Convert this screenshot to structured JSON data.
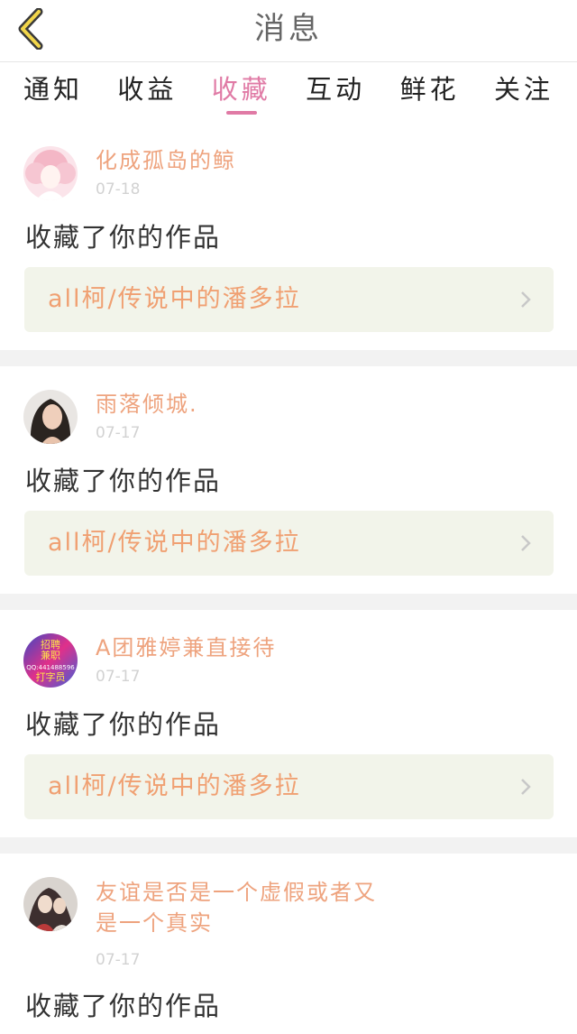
{
  "header": {
    "title": "消息"
  },
  "tabs": [
    {
      "label": "通知"
    },
    {
      "label": "收益"
    },
    {
      "label": "收藏",
      "active": true
    },
    {
      "label": "互动"
    },
    {
      "label": "鲜花"
    },
    {
      "label": "关注"
    }
  ],
  "items": [
    {
      "user": "化成孤岛的鲸",
      "date": "07-18",
      "action": "收藏了你的作品",
      "work": "all柯/传说中的潘多拉"
    },
    {
      "user": "雨落倾城.",
      "date": "07-17",
      "action": "收藏了你的作品",
      "work": "all柯/传说中的潘多拉"
    },
    {
      "user": "A团雅婷兼直接待",
      "date": "07-17",
      "action": "收藏了你的作品",
      "work": "all柯/传说中的潘多拉"
    },
    {
      "user": "友谊是否是一个虚假或者又是一个真实",
      "date": "07-17",
      "action": "收藏了你的作品"
    }
  ],
  "avatar_badge": {
    "line1": "招聘",
    "line2": "兼职",
    "line3": "QQ:441488596",
    "line4": "打字员"
  },
  "colors": {
    "accent": "#e07aa5",
    "username": "#eea37e",
    "work_link_bg": "#f2f4ea",
    "work_link_text": "#f0a072"
  }
}
